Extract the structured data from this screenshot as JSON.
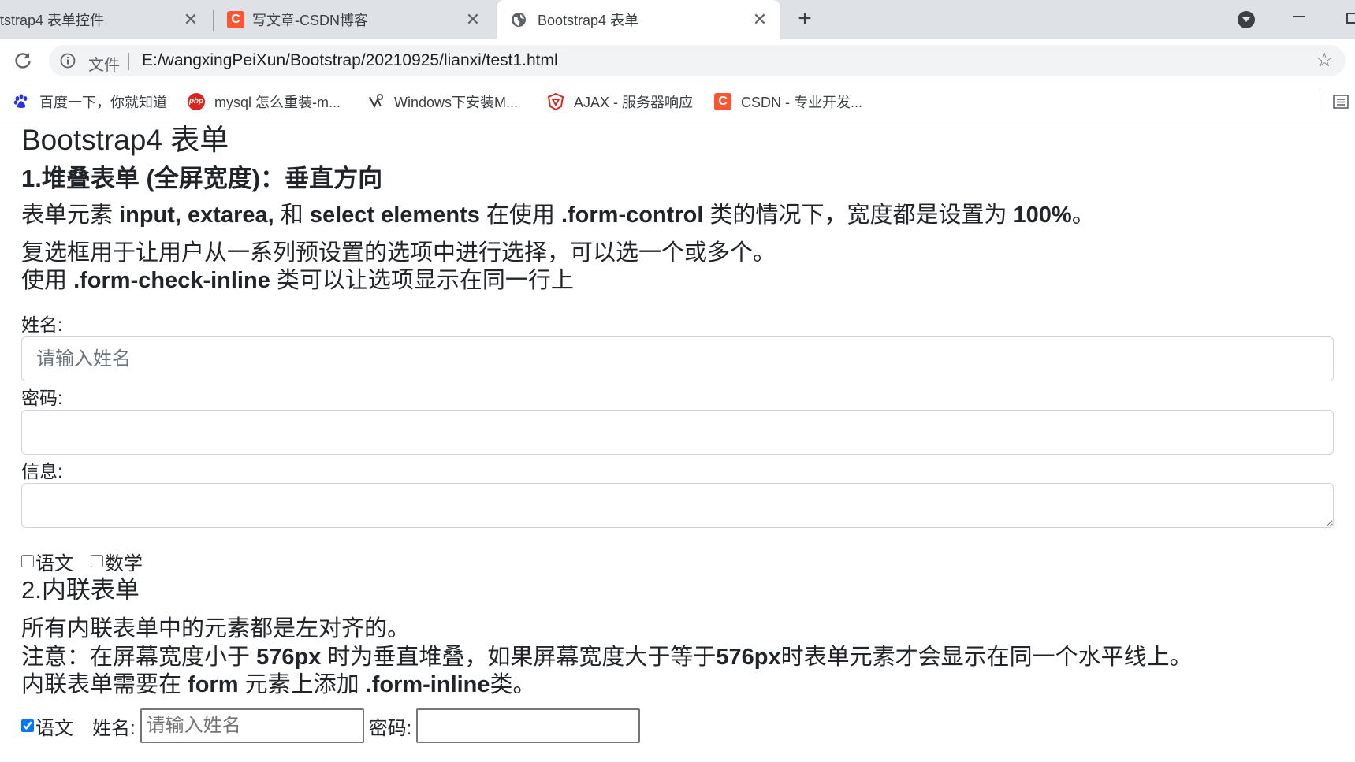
{
  "browser": {
    "tabs": [
      {
        "title": "tstrap4 表单控件",
        "active": false
      },
      {
        "title": "写文章-CSDN博客",
        "active": false
      },
      {
        "title": "Bootstrap4 表单",
        "active": true
      }
    ],
    "new_tab": "+",
    "address": {
      "scheme_label": "文件",
      "url": "E:/wangxingPeiXun/Bootstrap/20210925/lianxi/test1.html"
    },
    "bookmarks": [
      {
        "label": "百度一下，你就知道",
        "icon": "baidu-paw-icon"
      },
      {
        "label": "mysql 怎么重装-m...",
        "icon": "php-icon"
      },
      {
        "label": "Windows下安装M...",
        "icon": "bookmark-logo-icon"
      },
      {
        "label": "AJAX - 服务器响应",
        "icon": "w3-shield-icon"
      },
      {
        "label": "CSDN - 专业开发...",
        "icon": "csdn-icon"
      }
    ],
    "colors": {
      "tabstrip": "#dee1e6",
      "omnibox": "#f1f3f4",
      "csdn": "#fc5531",
      "active_tab": "#ffffff"
    }
  },
  "page": {
    "title": "Bootstrap4 表单",
    "section1": {
      "heading": "1.堆叠表单 (全屏宽度)：垂直方向",
      "p1_a": "表单元素 ",
      "p1_b": "input, extarea,",
      "p1_c": " 和 ",
      "p1_d": "select elements",
      "p1_e": " 在使用 ",
      "p1_f": ".form-control",
      "p1_g": " 类的情况下，宽度都是设置为 ",
      "p1_h": "100%",
      "p1_i": "。",
      "p2": "复选框用于让用户从一系列预设置的选项中进行选择，可以选一个或多个。",
      "p3_a": "使用 ",
      "p3_b": ".form-check-inline",
      "p3_c": " 类可以让选项显示在同一行上"
    },
    "form1": {
      "name_label": "姓名:",
      "name_placeholder": "请输入姓名",
      "name_value": "",
      "password_label": "密码:",
      "password_value": "",
      "message_label": "信息:",
      "message_value": "",
      "checkboxes": [
        {
          "label": "语文",
          "checked": false
        },
        {
          "label": "数学",
          "checked": false
        }
      ]
    },
    "section2": {
      "heading": "2.内联表单",
      "p4": "所有内联表单中的元素都是左对齐的。",
      "p5_a": "注意：在屏幕宽度小于 ",
      "p5_b": "576px",
      "p5_c": " 时为垂直堆叠，如果屏幕宽度大于等于",
      "p5_d": "576px",
      "p5_e": "时表单元素才会显示在同一个水平线上。",
      "p6_a": "内联表单需要在 ",
      "p6_b": "form",
      "p6_c": " 元素上添加 ",
      "p6_d": ".form-inline",
      "p6_e": "类。"
    },
    "form2": {
      "checkbox_label": "语文",
      "checkbox_checked": true,
      "name_label": "姓名:",
      "name_placeholder": "请输入姓名",
      "name_value": "",
      "password_label": "密码:",
      "password_value": ""
    }
  }
}
